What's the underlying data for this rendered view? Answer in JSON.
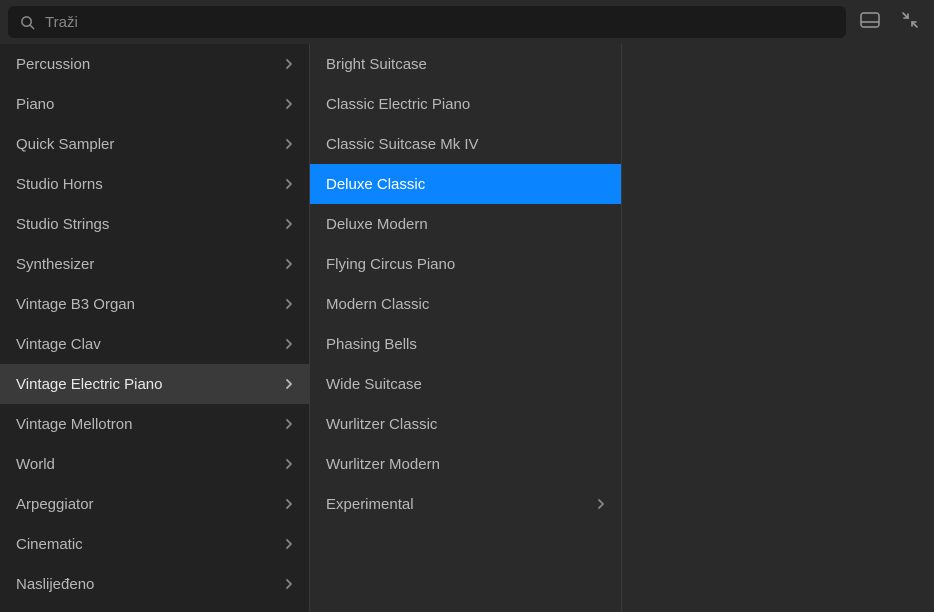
{
  "search": {
    "placeholder": "Traži"
  },
  "columnLeft": {
    "items": [
      {
        "label": "Percussion",
        "hasChildren": true,
        "active": false
      },
      {
        "label": "Piano",
        "hasChildren": true,
        "active": false
      },
      {
        "label": "Quick Sampler",
        "hasChildren": true,
        "active": false
      },
      {
        "label": "Studio Horns",
        "hasChildren": true,
        "active": false
      },
      {
        "label": "Studio Strings",
        "hasChildren": true,
        "active": false
      },
      {
        "label": "Synthesizer",
        "hasChildren": true,
        "active": false
      },
      {
        "label": "Vintage B3 Organ",
        "hasChildren": true,
        "active": false
      },
      {
        "label": "Vintage Clav",
        "hasChildren": true,
        "active": false
      },
      {
        "label": "Vintage Electric Piano",
        "hasChildren": true,
        "active": true
      },
      {
        "label": "Vintage Mellotron",
        "hasChildren": true,
        "active": false
      },
      {
        "label": "World",
        "hasChildren": true,
        "active": false
      },
      {
        "label": "Arpeggiator",
        "hasChildren": true,
        "active": false
      },
      {
        "label": "Cinematic",
        "hasChildren": true,
        "active": false
      },
      {
        "label": "Naslijeđeno",
        "hasChildren": true,
        "active": false
      }
    ]
  },
  "columnMiddle": {
    "items": [
      {
        "label": "Bright Suitcase",
        "hasChildren": false,
        "selected": false
      },
      {
        "label": "Classic Electric Piano",
        "hasChildren": false,
        "selected": false
      },
      {
        "label": "Classic Suitcase Mk IV",
        "hasChildren": false,
        "selected": false
      },
      {
        "label": "Deluxe Classic",
        "hasChildren": false,
        "selected": true
      },
      {
        "label": "Deluxe Modern",
        "hasChildren": false,
        "selected": false
      },
      {
        "label": "Flying Circus Piano",
        "hasChildren": false,
        "selected": false
      },
      {
        "label": "Modern Classic",
        "hasChildren": false,
        "selected": false
      },
      {
        "label": "Phasing Bells",
        "hasChildren": false,
        "selected": false
      },
      {
        "label": "Wide Suitcase",
        "hasChildren": false,
        "selected": false
      },
      {
        "label": "Wurlitzer Classic",
        "hasChildren": false,
        "selected": false
      },
      {
        "label": "Wurlitzer Modern",
        "hasChildren": false,
        "selected": false
      },
      {
        "label": "Experimental",
        "hasChildren": true,
        "selected": false
      }
    ]
  },
  "icons": {
    "panel": "panel-icon",
    "collapse": "collapse-icon"
  }
}
